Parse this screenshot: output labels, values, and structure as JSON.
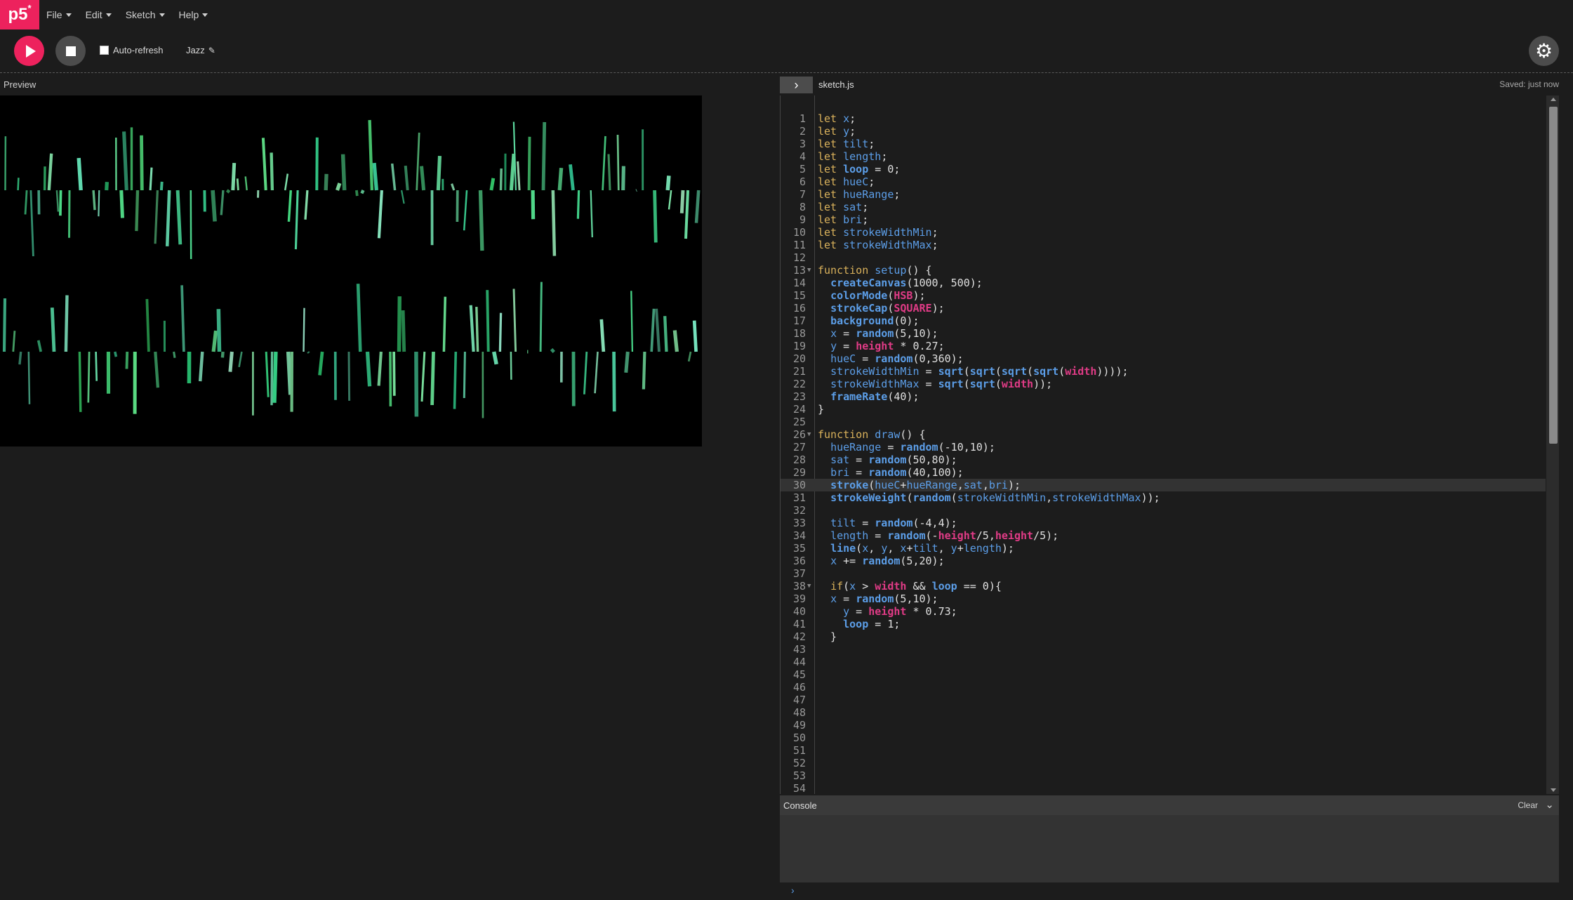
{
  "nav": {
    "logo": "p5",
    "logo_mark": "*",
    "menus": [
      "File",
      "Edit",
      "Sketch",
      "Help"
    ]
  },
  "toolbar": {
    "play_icon": "play-icon",
    "stop_icon": "stop-icon",
    "auto_refresh_label": "Auto-refresh",
    "auto_refresh_checked": false,
    "sketch_name": "Jazz",
    "settings_icon": "gear-icon"
  },
  "preview": {
    "label": "Preview",
    "background": "#000000",
    "stroke_color": "#8fe3b8"
  },
  "editor": {
    "file_name": "sketch.js",
    "status": "Saved: just now",
    "active_line": 30,
    "lines": [
      "let x;",
      "let y;",
      "let tilt;",
      "let length;",
      "let loop = 0;",
      "let hueC;",
      "let hueRange;",
      "let sat;",
      "let bri;",
      "let strokeWidthMin;",
      "let strokeWidthMax;",
      "",
      "function setup() {",
      "  createCanvas(1000, 500);",
      "  colorMode(HSB);",
      "  strokeCap(SQUARE);",
      "  background(0);",
      "  x = random(5,10);",
      "  y = height * 0.27;",
      "  hueC = random(0,360);",
      "  strokeWidthMin = sqrt(sqrt(sqrt(sqrt(width))));",
      "  strokeWidthMax = sqrt(sqrt(width));",
      "  frameRate(40);",
      "}",
      "",
      "function draw() {",
      "  hueRange = random(-10,10);",
      "  sat = random(50,80);",
      "  bri = random(40,100);",
      "  stroke(hueC+hueRange,sat,bri);",
      "  strokeWeight(random(strokeWidthMin,strokeWidthMax));",
      "",
      "  tilt = random(-4,4);",
      "  length = random(-height/5,height/5);",
      "  line(x, y, x+tilt, y+length);",
      "  x += random(5,20);",
      "",
      "  if(x > width && loop == 0){",
      "  x = random(5,10);",
      "    y = height * 0.73;",
      "    loop = 1;",
      "  }",
      "",
      "",
      "",
      "",
      "",
      "",
      "",
      "",
      "",
      "",
      "",
      ""
    ],
    "folds": [
      13,
      26,
      38
    ]
  },
  "console": {
    "title": "Console",
    "clear_label": "Clear",
    "prompt": "›"
  }
}
